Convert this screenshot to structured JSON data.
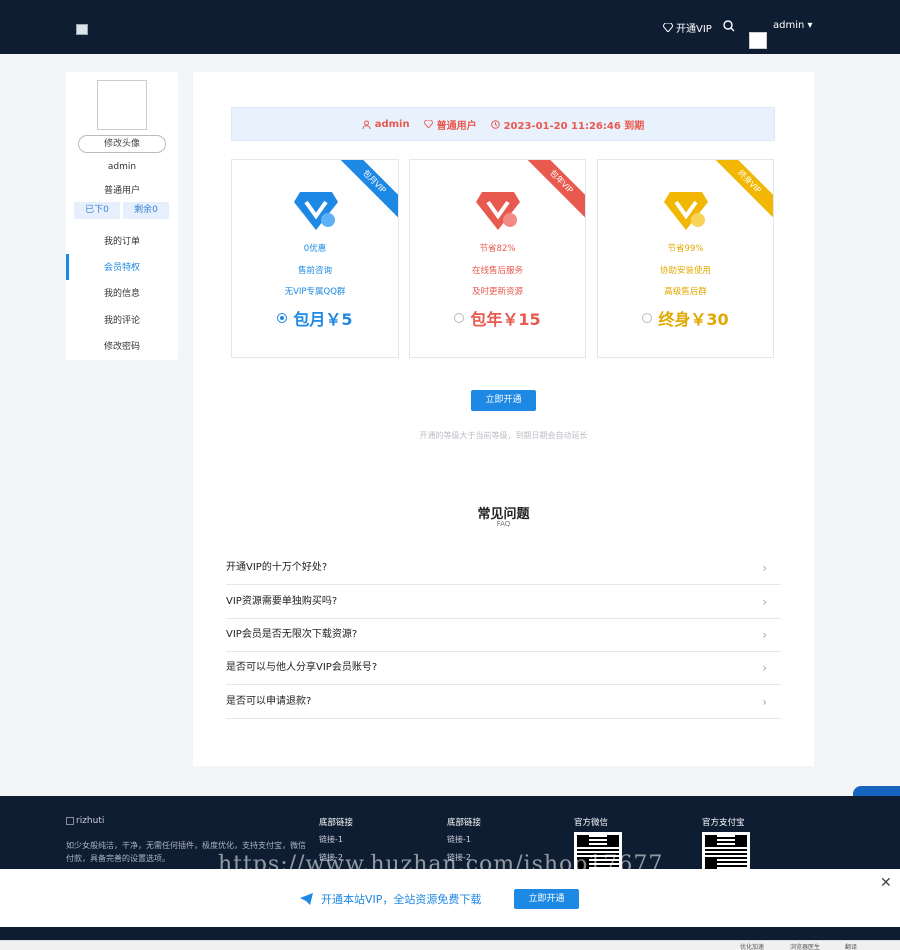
{
  "topbar": {
    "vip_label": "开通VIP",
    "user": "admin"
  },
  "sidebar": {
    "change_avatar": "修改头像",
    "username": "admin",
    "level": "普通用户",
    "downloaded": "已下0",
    "remaining": "剩余0",
    "menu": [
      {
        "label": "我的订单"
      },
      {
        "label": "会员特权"
      },
      {
        "label": "我的信息"
      },
      {
        "label": "我的评论"
      },
      {
        "label": "修改密码"
      }
    ]
  },
  "info_bar": {
    "user": "admin",
    "level": "普通用户",
    "expire": "2023-01-20 11:26:46 到期"
  },
  "plans": [
    {
      "ribbon": "包月VIP",
      "line1": "0优惠",
      "line2": "售前咨询",
      "line3": "无VIP专属QQ群",
      "price": "包月￥5",
      "color": "#1e88e5",
      "selected": true
    },
    {
      "ribbon": "包年VIP",
      "line1": "节省82%",
      "line2": "在线售后服务",
      "line3": "及时更新资源",
      "price": "包年￥15",
      "color": "#e8594f",
      "selected": false
    },
    {
      "ribbon": "终身VIP",
      "line1": "节省99%",
      "line2": "协助安装使用",
      "line3": "高级售后群",
      "price": "终身￥30",
      "color": "#f2b705",
      "selected": false
    }
  ],
  "open_button": "立即开通",
  "note": "开通的等级大于当前等级，到期日期会自动延长",
  "faq": {
    "title": "常见问题",
    "subtitle": "FAQ",
    "items": [
      "开通VIP的十万个好处?",
      "VIP资源需要单独购买吗?",
      "VIP会员是否无限次下载资源?",
      "是否可以与他人分享VIP会员账号?",
      "是否可以申请退款?"
    ]
  },
  "footer": {
    "logo_text": "rizhuti",
    "desc": "如少女般纯洁，干净，无需任何插件，极度优化，支持支付宝，微信付款，具备完善的设置选项。",
    "col1_title": "底部链接",
    "col1_links": [
      "链接-1",
      "链接-2"
    ],
    "col2_title": "底部链接",
    "col2_links": [
      "链接-1",
      "链接-2"
    ],
    "wechat_title": "官方微信",
    "alipay_title": "官方支付宝"
  },
  "watermark": "https://www.huzhan.com/ishop17677",
  "promo": {
    "message": "开通本站VIP，全站资源免费下载",
    "button": "立即开通"
  },
  "float_tool": "中",
  "statusbar": [
    "优化加速",
    "浏览器医生",
    "翻译"
  ]
}
